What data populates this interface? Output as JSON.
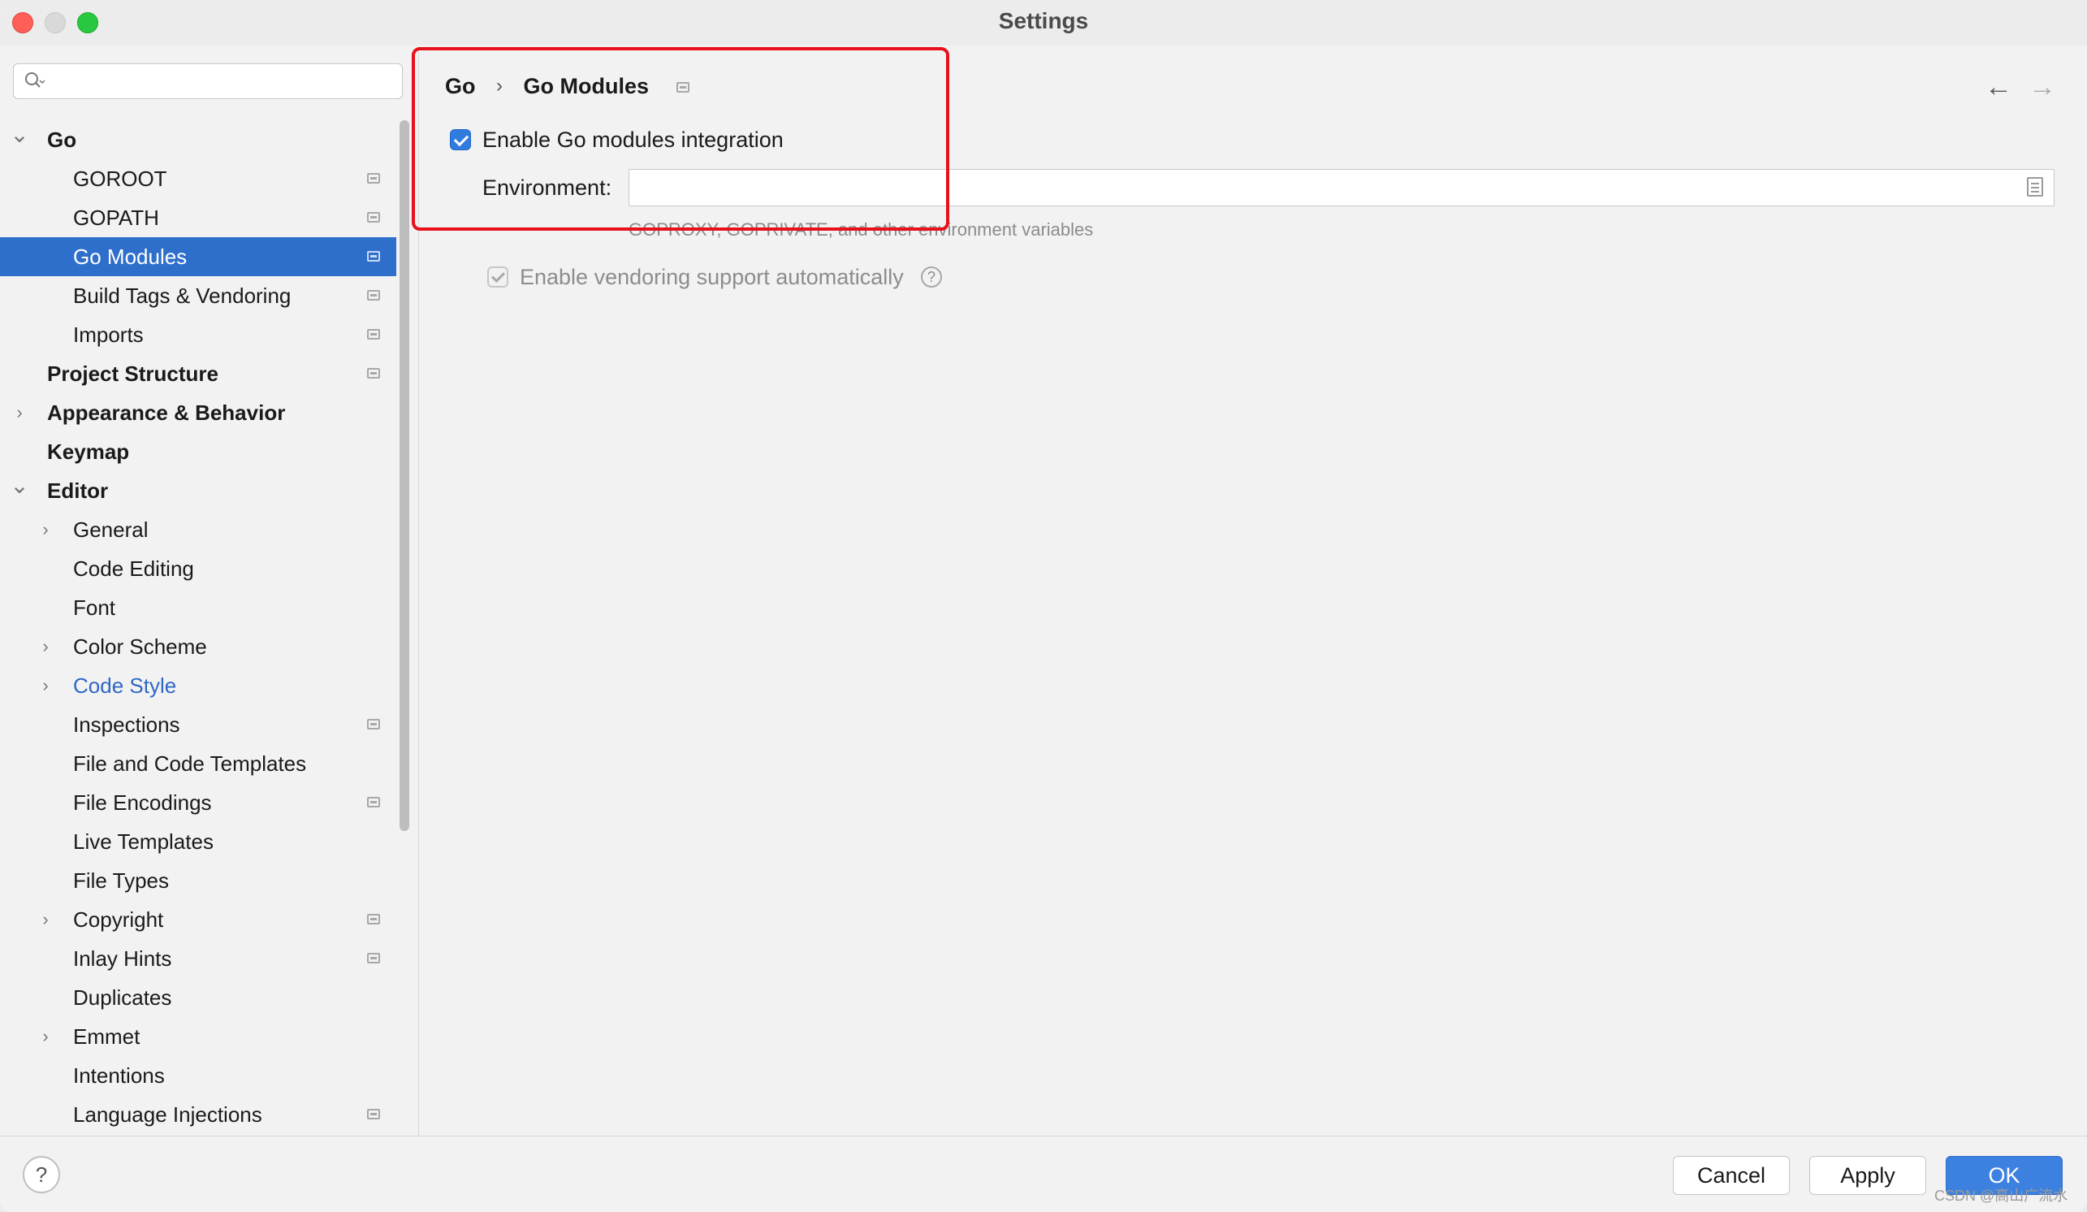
{
  "window": {
    "title": "Settings"
  },
  "search": {
    "placeholder": ""
  },
  "tree": [
    {
      "label": "Go",
      "indent": 0,
      "chevron": "down",
      "bold": true,
      "project": false
    },
    {
      "label": "GOROOT",
      "indent": 1,
      "chevron": "",
      "bold": false,
      "project": true
    },
    {
      "label": "GOPATH",
      "indent": 1,
      "chevron": "",
      "bold": false,
      "project": true
    },
    {
      "label": "Go Modules",
      "indent": 1,
      "chevron": "",
      "bold": false,
      "project": true,
      "selected": true
    },
    {
      "label": "Build Tags & Vendoring",
      "indent": 1,
      "chevron": "",
      "bold": false,
      "project": true
    },
    {
      "label": "Imports",
      "indent": 1,
      "chevron": "",
      "bold": false,
      "project": true
    },
    {
      "label": "Project Structure",
      "indent": 0,
      "chevron": "",
      "bold": true,
      "project": true
    },
    {
      "label": "Appearance & Behavior",
      "indent": 0,
      "chevron": "right",
      "bold": true,
      "project": false
    },
    {
      "label": "Keymap",
      "indent": 0,
      "chevron": "",
      "bold": true,
      "project": false
    },
    {
      "label": "Editor",
      "indent": 0,
      "chevron": "down",
      "bold": true,
      "project": false
    },
    {
      "label": "General",
      "indent": 1,
      "chevron": "right",
      "bold": false,
      "project": false
    },
    {
      "label": "Code Editing",
      "indent": 1,
      "chevron": "",
      "bold": false,
      "project": false
    },
    {
      "label": "Font",
      "indent": 1,
      "chevron": "",
      "bold": false,
      "project": false
    },
    {
      "label": "Color Scheme",
      "indent": 1,
      "chevron": "right",
      "bold": false,
      "project": false
    },
    {
      "label": "Code Style",
      "indent": 1,
      "chevron": "right",
      "bold": false,
      "project": false,
      "link": true
    },
    {
      "label": "Inspections",
      "indent": 1,
      "chevron": "",
      "bold": false,
      "project": true
    },
    {
      "label": "File and Code Templates",
      "indent": 1,
      "chevron": "",
      "bold": false,
      "project": false
    },
    {
      "label": "File Encodings",
      "indent": 1,
      "chevron": "",
      "bold": false,
      "project": true
    },
    {
      "label": "Live Templates",
      "indent": 1,
      "chevron": "",
      "bold": false,
      "project": false
    },
    {
      "label": "File Types",
      "indent": 1,
      "chevron": "",
      "bold": false,
      "project": false
    },
    {
      "label": "Copyright",
      "indent": 1,
      "chevron": "right",
      "bold": false,
      "project": true
    },
    {
      "label": "Inlay Hints",
      "indent": 1,
      "chevron": "",
      "bold": false,
      "project": true
    },
    {
      "label": "Duplicates",
      "indent": 1,
      "chevron": "",
      "bold": false,
      "project": false
    },
    {
      "label": "Emmet",
      "indent": 1,
      "chevron": "right",
      "bold": false,
      "project": false
    },
    {
      "label": "Intentions",
      "indent": 1,
      "chevron": "",
      "bold": false,
      "project": false
    },
    {
      "label": "Language Injections",
      "indent": 1,
      "chevron": "",
      "bold": false,
      "project": true
    }
  ],
  "breadcrumb": {
    "parent": "Go",
    "separator": "›",
    "current": "Go Modules"
  },
  "nav": {
    "back": "←",
    "forward": "→"
  },
  "modules": {
    "enable_label": "Enable Go modules integration",
    "enable_checked": true,
    "environment_label": "Environment:",
    "environment_value": "",
    "environment_hint": "GOPROXY, GOPRIVATE, and other environment variables",
    "vendoring_label": "Enable vendoring support automatically",
    "vendoring_checked": true,
    "vendoring_enabled": false,
    "help_mark": "?"
  },
  "footer": {
    "help": "?",
    "cancel": "Cancel",
    "apply": "Apply",
    "ok": "OK",
    "watermark": "CSDN @高山广流水"
  },
  "colors": {
    "accent": "#2f6fcc",
    "highlight_box": "#e8101a",
    "link": "#2f67c8"
  }
}
